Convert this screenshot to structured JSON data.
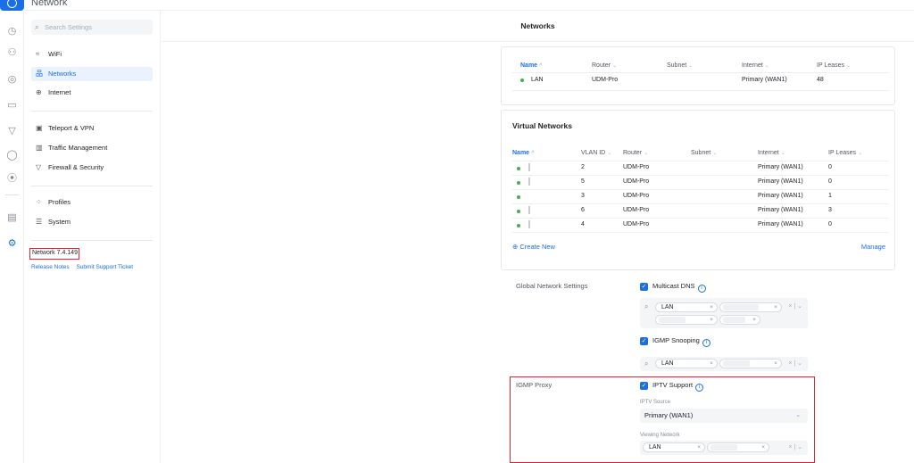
{
  "app": {
    "title": "Network",
    "version": "Network 7.4.149"
  },
  "search": {
    "placeholder": "Search Settings"
  },
  "sidebar": {
    "items": [
      {
        "label": "WiFi",
        "icon": "wifi-icon"
      },
      {
        "label": "Networks",
        "icon": "networks-icon",
        "active": true
      },
      {
        "label": "Internet",
        "icon": "globe-icon"
      },
      {
        "label": "Teleport & VPN",
        "icon": "vpn-icon"
      },
      {
        "label": "Traffic Management",
        "icon": "traffic-icon"
      },
      {
        "label": "Firewall & Security",
        "icon": "shield-icon"
      },
      {
        "label": "Profiles",
        "icon": "profiles-icon"
      },
      {
        "label": "System",
        "icon": "system-icon"
      }
    ],
    "links": {
      "release_notes": "Release Notes",
      "support": "Submit Support Ticket"
    }
  },
  "page": {
    "title": "Networks"
  },
  "networks_table": {
    "columns": [
      "Name",
      "Router",
      "Subnet",
      "Internet",
      "IP Leases"
    ],
    "rows": [
      {
        "name": "LAN",
        "router": "UDM-Pro",
        "subnet": "",
        "internet": "Primary (WAN1)",
        "leases": "48"
      }
    ]
  },
  "virtual_networks": {
    "title": "Virtual Networks",
    "columns": [
      "Name",
      "VLAN ID",
      "Router",
      "Subnet",
      "Internet",
      "IP Leases"
    ],
    "rows": [
      {
        "name": "",
        "vlan": "2",
        "router": "UDM-Pro",
        "subnet": "",
        "internet": "Primary (WAN1)",
        "leases": "0"
      },
      {
        "name": "",
        "vlan": "5",
        "router": "UDM-Pro",
        "subnet": "",
        "internet": "Primary (WAN1)",
        "leases": "0"
      },
      {
        "name": "",
        "vlan": "3",
        "router": "UDM-Pro",
        "subnet": "",
        "internet": "Primary (WAN1)",
        "leases": "1"
      },
      {
        "name": "",
        "vlan": "6",
        "router": "UDM-Pro",
        "subnet": "",
        "internet": "Primary (WAN1)",
        "leases": "3"
      },
      {
        "name": "",
        "vlan": "4",
        "router": "UDM-Pro",
        "subnet": "",
        "internet": "Primary (WAN1)",
        "leases": "0"
      }
    ],
    "create_label": "Create New",
    "manage_label": "Manage"
  },
  "global_settings": {
    "label": "Global Network Settings",
    "multicast_dns": {
      "label": "Multicast DNS",
      "checked": true,
      "chips": [
        "LAN",
        "",
        "",
        ""
      ]
    },
    "igmp_snooping": {
      "label": "IGMP Snooping",
      "checked": true,
      "chips": [
        "LAN",
        ""
      ]
    }
  },
  "igmp_proxy": {
    "label": "IGMP Proxy",
    "iptv": {
      "label": "IPTV Support",
      "checked": true
    },
    "iptv_source": {
      "label": "IPTV Source",
      "value": "Primary (WAN1)"
    },
    "viewing_network": {
      "label": "Viewing Network",
      "chips": [
        "LAN",
        ""
      ]
    }
  },
  "colors": {
    "accent": "#1a6ee8",
    "highlight": "#d9282e",
    "online": "#39b54a"
  }
}
